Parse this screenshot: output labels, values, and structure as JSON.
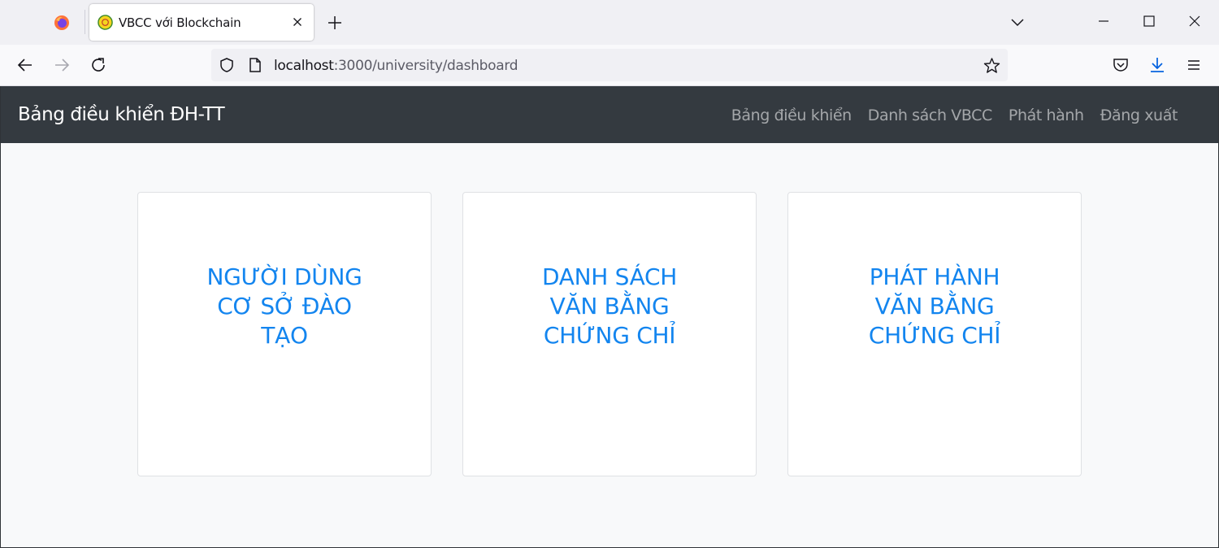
{
  "browser": {
    "tab_title": "VBCC với Blockchain",
    "url_host": "localhost",
    "url_path": ":3000/university/dashboard",
    "icons": [
      "firefox-icon",
      "close-icon",
      "plus-icon",
      "chevron-down-icon",
      "minimize-icon",
      "maximize-icon",
      "close-window-icon",
      "back-icon",
      "forward-icon",
      "reload-icon",
      "shield-icon",
      "page-icon",
      "star-icon",
      "pocket-icon",
      "download-icon",
      "menu-icon"
    ],
    "accent": "#0060df"
  },
  "header": {
    "brand": "Bảng điều khiển ĐH-TT",
    "menu": [
      {
        "label": "Bảng điều khiển"
      },
      {
        "label": "Danh sách VBCC"
      },
      {
        "label": "Phát hành"
      },
      {
        "label": "Đăng xuất"
      }
    ],
    "background": "#343a40"
  },
  "cards": [
    {
      "title": "NGƯỜI DÙNG CƠ SỞ ĐÀO TẠO"
    },
    {
      "title": "DANH SÁCH VĂN BẰNG CHỨNG CHỈ"
    },
    {
      "title": "PHÁT HÀNH VĂN BẰNG CHỨNG CHỈ"
    }
  ],
  "colors": {
    "card_text": "#1385ef",
    "page_bg": "#f8f9fa"
  }
}
